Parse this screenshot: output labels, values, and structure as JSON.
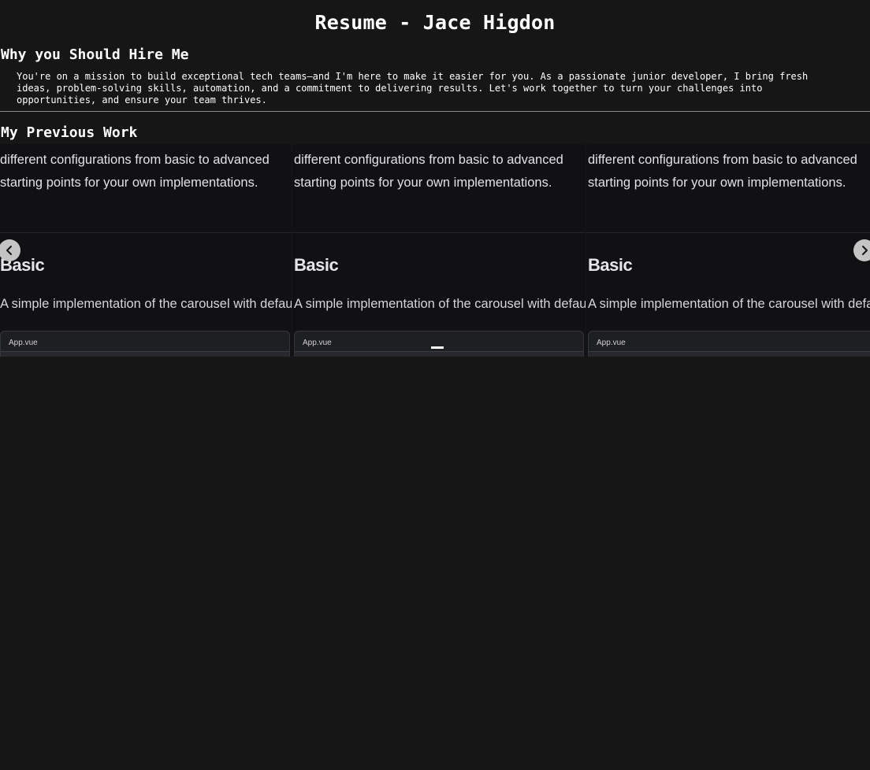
{
  "page": {
    "title": "Resume - Jace Higdon"
  },
  "why_section": {
    "heading": "Why you Should Hire Me",
    "body": "You're on a mission to build exceptional tech teams—and I'm here to make it easier for you. As a passionate junior developer, I bring fresh ideas, problem-solving skills, automation, and a commitment to delivering results. Let's work together to turn your challenges into opportunities, and ensure your team thrives."
  },
  "work_section": {
    "heading": "My Previous Work",
    "carousel": {
      "slides": [
        {
          "desc_line_1": "different configurations from basic to advanced",
          "desc_line_2": "starting points for your own implementations.",
          "title": "Basic",
          "description": "A simple implementation of the carousel with default",
          "code_tab": "App.vue"
        },
        {
          "desc_line_1": "different configurations from basic to advanced",
          "desc_line_2": "starting points for your own implementations.",
          "title": "Basic",
          "description": "A simple implementation of the carousel with default",
          "code_tab": "App.vue"
        },
        {
          "desc_line_1": "different configurations from basic to advanced",
          "desc_line_2": "starting points for your own implementations.",
          "title": "Basic",
          "description": "A simple implementation of the carousel with default",
          "code_tab": "App.vue"
        }
      ],
      "prev_icon": "chevron-left-icon",
      "next_icon": "chevron-right-icon"
    }
  },
  "colors": {
    "background": "#161616",
    "text": "#ffffff",
    "divider": "#8a8a8a",
    "nav_button": "#c4c4c4"
  }
}
